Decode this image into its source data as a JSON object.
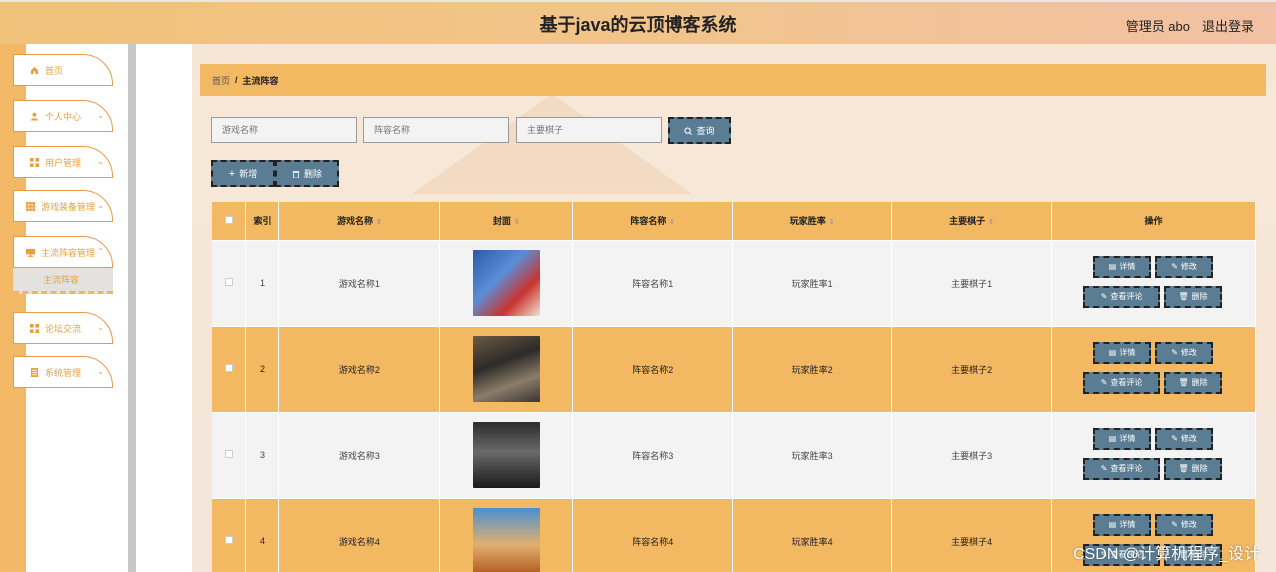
{
  "header": {
    "title": "基于java的云顶博客系统",
    "user": "管理员 abo",
    "logout": "退出登录"
  },
  "sidebar": {
    "items": [
      {
        "label": "首页",
        "icon": "home-icon"
      },
      {
        "label": "个人中心",
        "icon": "user-icon"
      },
      {
        "label": "用户管理",
        "icon": "grid-icon"
      },
      {
        "label": "游戏装备管理",
        "icon": "grid-icon"
      },
      {
        "label": "主流阵容管理",
        "icon": "monitor-icon"
      },
      {
        "label": "论坛交流",
        "icon": "grid-icon"
      },
      {
        "label": "系统管理",
        "icon": "doc-icon"
      }
    ],
    "active_sub": "主流阵容"
  },
  "breadcrumb": {
    "home": "首页",
    "sep": "/",
    "current": "主流阵容"
  },
  "search": {
    "game_placeholder": "游戏名称",
    "lineup_placeholder": "阵容名称",
    "chess_placeholder": "主要棋子",
    "query_label": "查询"
  },
  "actions": {
    "add_label": "新增",
    "delete_label": "删除"
  },
  "table": {
    "headers": [
      "索引",
      "游戏名称",
      "封面",
      "阵容名称",
      "玩家胜率",
      "主要棋子",
      "操作"
    ],
    "ops": {
      "detail": "详情",
      "edit": "修改",
      "review": "查看评论",
      "delete": "删除"
    },
    "rows": [
      {
        "index": "1",
        "game": "游戏名称1",
        "lineup": "阵容名称1",
        "winrate": "玩家胜率1",
        "chess": "主要棋子1"
      },
      {
        "index": "2",
        "game": "游戏名称2",
        "lineup": "阵容名称2",
        "winrate": "玩家胜率2",
        "chess": "主要棋子2"
      },
      {
        "index": "3",
        "game": "游戏名称3",
        "lineup": "阵容名称3",
        "winrate": "玩家胜率3",
        "chess": "主要棋子3"
      },
      {
        "index": "4",
        "game": "游戏名称4",
        "lineup": "阵容名称4",
        "winrate": "玩家胜率4",
        "chess": "主要棋子4"
      }
    ]
  },
  "watermark": "CSDN @计算机程序_设计",
  "colors": {
    "accent": "#f2b862",
    "button": "#5b7d93",
    "menu": "#e89a4a"
  }
}
